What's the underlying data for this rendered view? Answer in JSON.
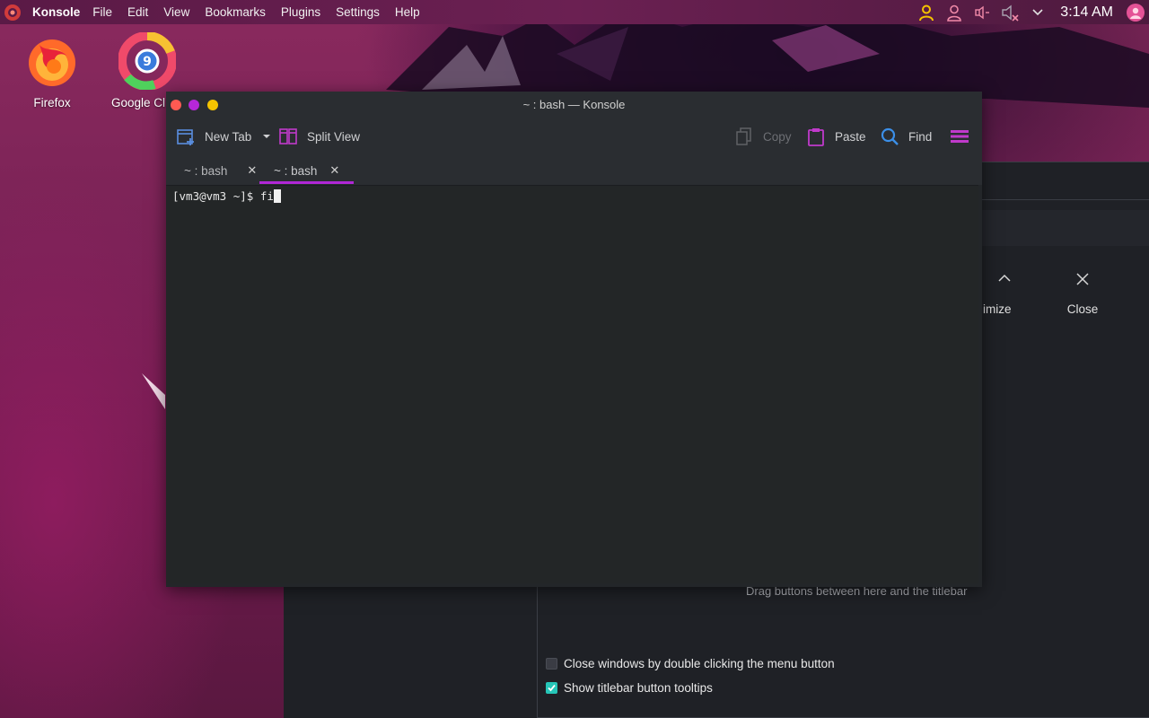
{
  "panel": {
    "app_name": "Konsole",
    "menu": [
      "File",
      "Edit",
      "View",
      "Bookmarks",
      "Plugins",
      "Settings",
      "Help"
    ],
    "clock": "3:14 AM",
    "tray_icons": [
      "user-icon",
      "user-outline-icon",
      "audio-icon",
      "volume-muted-icon",
      "chevron-down-icon",
      "avatar-icon"
    ]
  },
  "desktop": {
    "icons": [
      {
        "name": "firefox",
        "label": "Firefox"
      },
      {
        "name": "google-chrome",
        "label": "Google Cl"
      }
    ]
  },
  "background_window": {
    "maximize_label": "imize",
    "close_label": "Close",
    "drag_hint": "Drag buttons between here and the titlebar",
    "checkbox_double_click": {
      "label": "Close windows by double clicking the menu button",
      "checked": false
    },
    "checkbox_tooltips": {
      "label": "Show titlebar button tooltips",
      "checked": true
    }
  },
  "konsole": {
    "title": "~ : bash — Konsole",
    "toolbar": {
      "new_tab": "New Tab",
      "split_view": "Split View",
      "copy": "Copy",
      "paste": "Paste",
      "find": "Find"
    },
    "tabs": [
      {
        "label": "~ : bash",
        "active": false
      },
      {
        "label": "~ : bash",
        "active": true
      }
    ],
    "terminal": {
      "prompt": "[vm3@vm3 ~]$ ",
      "input": "fi"
    }
  },
  "colors": {
    "accent_purple": "#b027d6",
    "find_blue": "#3b8fe8",
    "check_teal": "#26c6b8",
    "tray_yellow": "#f5c400",
    "close_dot": "#ff5a52",
    "mid_dot": "#b627d8",
    "min_dot": "#f5c400"
  }
}
